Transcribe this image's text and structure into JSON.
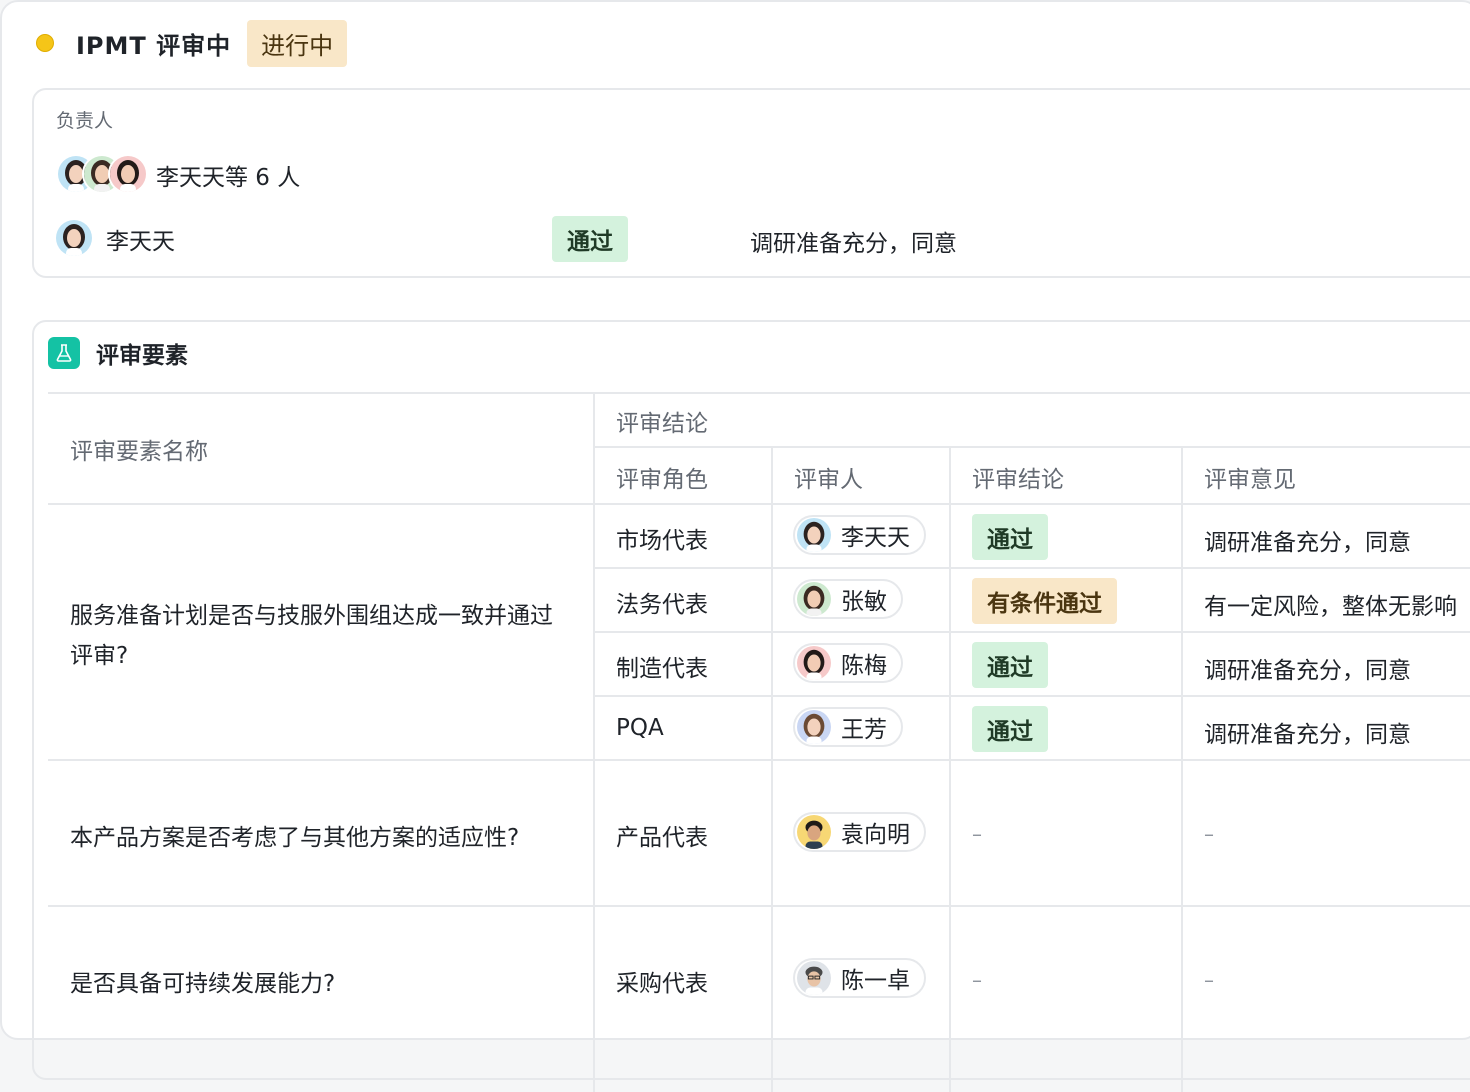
{
  "header": {
    "title": "IPMT 评审中",
    "status": "进行中",
    "status_dot_color": "#f5c518"
  },
  "owner": {
    "label": "负责人",
    "summary": "李天天等 6 人",
    "row": {
      "name": "李天天",
      "result": "通过",
      "comment": "调研准备充分，同意"
    }
  },
  "section": {
    "title": "评审要素",
    "icon": "flask-icon",
    "accent_color": "#14c2a4",
    "headers": {
      "element_name": "评审要素名称",
      "conclusion_group": "评审结论",
      "role": "评审角色",
      "reviewer": "评审人",
      "conclusion": "评审结论",
      "opinion": "评审意见"
    },
    "groups": [
      {
        "name": "服务准备计划是否与技服外围组达成一致并通过评审?",
        "rows": [
          {
            "role": "市场代表",
            "reviewer": "李天天",
            "result": "通过",
            "opinion": "调研准备充分，同意"
          },
          {
            "role": "法务代表",
            "reviewer": "张敏",
            "result": "有条件通过",
            "opinion": "有一定风险，整体无影响"
          },
          {
            "role": "制造代表",
            "reviewer": "陈梅",
            "result": "通过",
            "opinion": "调研准备充分，同意"
          },
          {
            "role": "PQA",
            "reviewer": "王芳",
            "result": "通过",
            "opinion": "调研准备充分，同意"
          }
        ]
      },
      {
        "name": "本产品方案是否考虑了与其他方案的适应性?",
        "rows": [
          {
            "role": "产品代表",
            "reviewer": "袁向明",
            "result": "–",
            "opinion": "–"
          }
        ]
      },
      {
        "name": "是否具备可持续发展能力?",
        "rows": [
          {
            "role": "采购代表",
            "reviewer": "陈一卓",
            "result": "–",
            "opinion": "–"
          }
        ]
      }
    ]
  },
  "colors": {
    "pass_bg": "#d4f2dd",
    "conditional_bg": "#f9e7c8"
  }
}
